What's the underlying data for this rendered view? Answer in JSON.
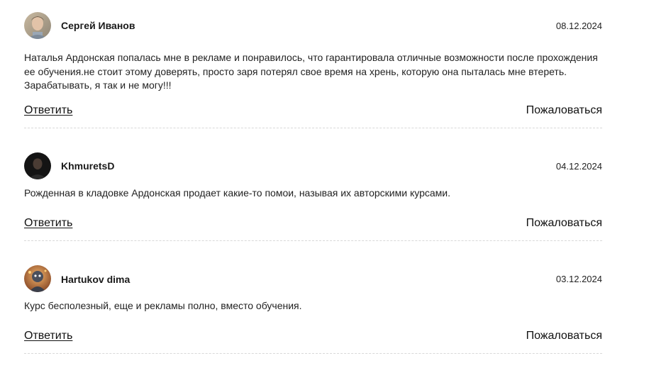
{
  "comments": [
    {
      "author": "Сергей Иванов",
      "date": "08.12.2024",
      "avatar_icon": "user-photo-avatar",
      "text": "Наталья Ардонская попалась мне в рекламе и понравилось, что гарантировала отличные возможности после прохождения ее обучения.не стоит этому доверять, просто заря потерял свое время на хрень, которую она пыталась мне втереть. Зарабатывать, я так и не могу!!!",
      "reply_label": "Ответить",
      "report_label": "Пожаловаться"
    },
    {
      "author": "KhmuretsD",
      "date": "04.12.2024",
      "avatar_icon": "user-photo-avatar",
      "text": "Рожденная в кладовке Ардонская продает какие-то помои, называя их авторскими курсами.",
      "reply_label": "Ответить",
      "report_label": "Пожаловаться"
    },
    {
      "author": "Hartukov dima",
      "date": "03.12.2024",
      "avatar_icon": "user-photo-avatar",
      "text": "Курс бесполезный, еще и рекламы полно, вместо обучения.",
      "reply_label": "Ответить",
      "report_label": "Пожаловаться"
    }
  ]
}
